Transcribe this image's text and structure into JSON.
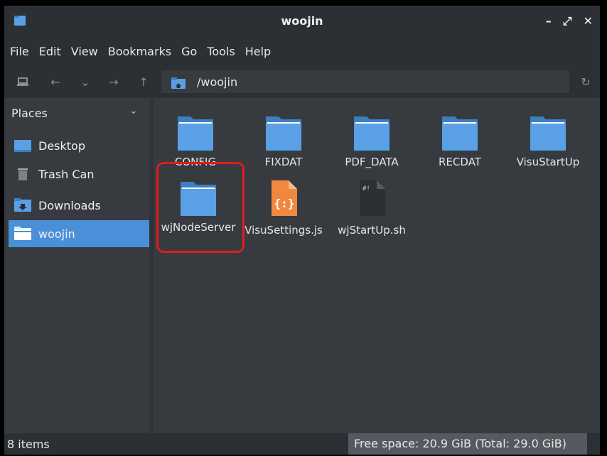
{
  "window": {
    "title": "woojin"
  },
  "wm": {
    "minimize": "–",
    "maximize": "⤢",
    "close": "✕"
  },
  "menubar": {
    "items": [
      "File",
      "Edit",
      "View",
      "Bookmarks",
      "Go",
      "Tools",
      "Help"
    ]
  },
  "toolbar": {
    "path": "/woojin",
    "icons": [
      "computer-icon",
      "back-arrow-icon",
      "history-dropdown-icon",
      "forward-arrow-icon",
      "up-arrow-icon",
      "home-folder-icon",
      "reload-icon"
    ]
  },
  "sidebar": {
    "header": "Places",
    "items": [
      {
        "label": "Desktop",
        "icon": "desktop-folder-icon"
      },
      {
        "label": "Trash Can",
        "icon": "trash-icon"
      },
      {
        "label": "Downloads",
        "icon": "downloads-folder-icon"
      },
      {
        "label": "woojin",
        "icon": "home-folder-icon",
        "selected": true
      }
    ]
  },
  "files": [
    {
      "name": "CONFIG",
      "type": "folder"
    },
    {
      "name": "FIXDAT",
      "type": "folder"
    },
    {
      "name": "PDF_DATA",
      "type": "folder"
    },
    {
      "name": "RECDAT",
      "type": "folder"
    },
    {
      "name": "VisuStartUp",
      "type": "folder"
    },
    {
      "name": "wjNodeServer",
      "type": "folder"
    },
    {
      "name": "VisuSettings.js",
      "type": "javascript"
    },
    {
      "name": "wjStartUp.sh",
      "type": "shell-script"
    }
  ],
  "status": {
    "items": "8 items",
    "free_space": "Free space: 20.9 GiB (Total: 29.0 GiB)"
  },
  "colors": {
    "accent": "#4a90d9",
    "folder": "#5aa0e6",
    "js_icon": "#f0883e",
    "annotation": "#e01c1c"
  }
}
